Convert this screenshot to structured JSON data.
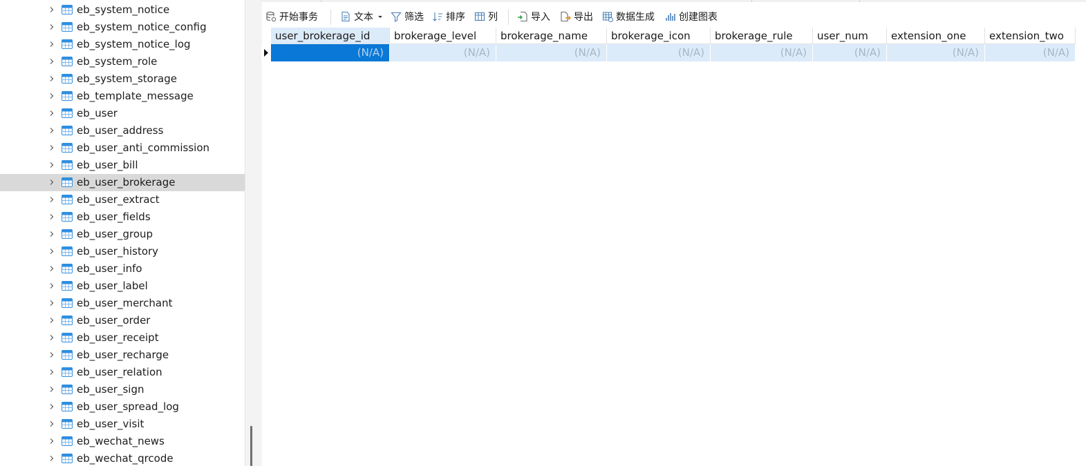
{
  "sidebar": {
    "items": [
      {
        "label": "eb_system_notice"
      },
      {
        "label": "eb_system_notice_config"
      },
      {
        "label": "eb_system_notice_log"
      },
      {
        "label": "eb_system_role"
      },
      {
        "label": "eb_system_storage"
      },
      {
        "label": "eb_template_message"
      },
      {
        "label": "eb_user"
      },
      {
        "label": "eb_user_address"
      },
      {
        "label": "eb_user_anti_commission"
      },
      {
        "label": "eb_user_bill"
      },
      {
        "label": "eb_user_brokerage",
        "selected": true
      },
      {
        "label": "eb_user_extract"
      },
      {
        "label": "eb_user_fields"
      },
      {
        "label": "eb_user_group"
      },
      {
        "label": "eb_user_history"
      },
      {
        "label": "eb_user_info"
      },
      {
        "label": "eb_user_label"
      },
      {
        "label": "eb_user_merchant"
      },
      {
        "label": "eb_user_order"
      },
      {
        "label": "eb_user_receipt"
      },
      {
        "label": "eb_user_recharge"
      },
      {
        "label": "eb_user_relation"
      },
      {
        "label": "eb_user_sign"
      },
      {
        "label": "eb_user_spread_log"
      },
      {
        "label": "eb_user_visit"
      },
      {
        "label": "eb_wechat_news"
      },
      {
        "label": "eb_wechat_qrcode"
      }
    ]
  },
  "toolbar": {
    "begin_transaction": "开始事务",
    "text": "文本",
    "filter": "筛选",
    "sort": "排序",
    "columns": "列",
    "import": "导入",
    "export": "导出",
    "data_generation": "数据生成",
    "create_chart": "创建图表"
  },
  "grid": {
    "columns": [
      "user_brokerage_id",
      "brokerage_level",
      "brokerage_name",
      "brokerage_icon",
      "brokerage_rule",
      "user_num",
      "extension_one",
      "extension_two"
    ],
    "row": [
      "(N/A)",
      "(N/A)",
      "(N/A)",
      "(N/A)",
      "(N/A)",
      "(N/A)",
      "(N/A)",
      "(N/A)"
    ]
  },
  "colors": {
    "accent": "#0a78d7",
    "row_highlight": "#dcebfa",
    "selected_tree_row": "#d9d9d9",
    "table_icon": "#2f8fe0"
  }
}
